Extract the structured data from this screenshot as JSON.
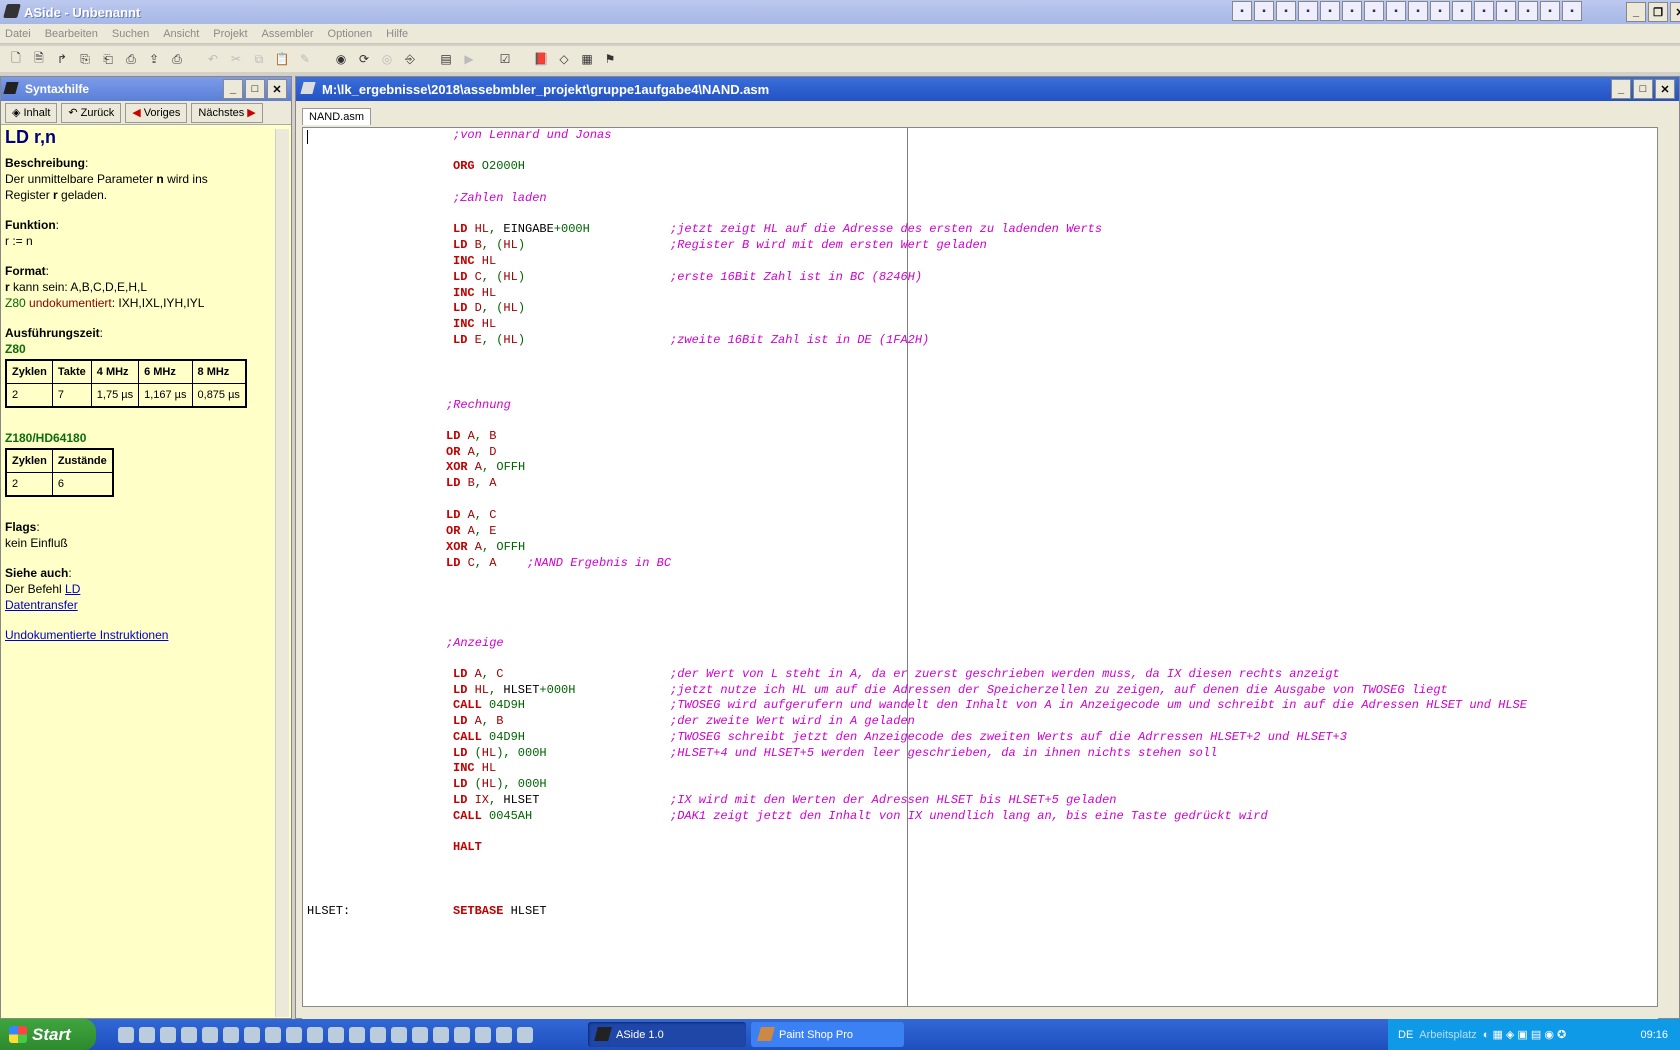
{
  "window": {
    "title": "ASide - Unbenannt"
  },
  "menu": [
    "Datei",
    "Bearbeiten",
    "Suchen",
    "Ansicht",
    "Projekt",
    "Assembler",
    "Optionen",
    "Hilfe"
  ],
  "quicklaunch_icons": [
    "icon-1",
    "icon-2",
    "icon-3",
    "icon-4",
    "icon-5",
    "icon-6",
    "icon-7",
    "icon-8",
    "icon-9",
    "icon-10",
    "icon-11",
    "icon-12",
    "icon-13",
    "icon-14",
    "icon-15",
    "icon-16"
  ],
  "left_panel": {
    "title": "Syntaxhilfe",
    "nav": {
      "inhalt": "Inhalt",
      "zurueck": "Zurück",
      "voriges": "Voriges",
      "naechstes": "Nächstes"
    },
    "heading": "LD r,n",
    "beschreibung_label": "Beschreibung",
    "beschreibung_text1": "Der unmittelbare Parameter ",
    "beschreibung_n": "n",
    "beschreibung_text2": " wird ins",
    "beschreibung_text3": "Register ",
    "beschreibung_r": "r",
    "beschreibung_text4": " geladen.",
    "funktion_label": "Funktion",
    "funktion_text": "r := n",
    "format_label": "Format",
    "format_r": "r",
    "format_text": " kann sein: A,B,C,D,E,H,L",
    "format_z80": "Z80",
    "format_undok": " undokumentiert",
    "format_undok_text": ": IXH,IXL,IYH,IYL",
    "zeit_label": "Ausführungszeit",
    "z80_label": "Z80",
    "z80_table": {
      "headers": [
        "Zyklen",
        "Takte",
        "4 MHz",
        "6 MHz",
        "8 MHz"
      ],
      "row": [
        "2",
        "7",
        "1,75 µs",
        "1,167 µs",
        "0,875 µs"
      ]
    },
    "z180_label": "Z180/HD64180",
    "z180_table": {
      "headers": [
        "Zyklen",
        "Zustände"
      ],
      "row": [
        "2",
        "6"
      ]
    },
    "flags_label": "Flags",
    "flags_text": "kein Einfluß",
    "siehe_label": "Siehe auch",
    "siehe_text": "Der Befehl ",
    "siehe_ld": "LD",
    "siehe_daten": "Datentransfer",
    "undok_link": "Undokumentierte Instruktionen"
  },
  "editor": {
    "title": "M:\\lk_ergebnisse\\2018\\assebmbler_projekt\\gruppe1aufgabe4\\NAND.asm",
    "tab": "NAND.asm",
    "lines": [
      {
        "l": "",
        "k": "",
        "a": "",
        "c": ";von Lennard und Jonas"
      },
      {
        "l": "",
        "k": "ORG",
        "a": " O2000H",
        "c": ""
      },
      {
        "l": "",
        "k": "",
        "a": "",
        "c": ";Zahlen laden"
      },
      {
        "l": "",
        "k": "LD",
        "a": " HL, EINGABE+000H",
        "c": ";jetzt zeigt HL auf die Adresse des ersten zu ladenden Werts"
      },
      {
        "l": "",
        "k": "LD",
        "a": " B, (HL)",
        "c": ";Register B wird mit dem ersten Wert geladen"
      },
      {
        "l": "",
        "k": "INC",
        "a": " HL",
        "c": ""
      },
      {
        "l": "",
        "k": "LD",
        "a": " C, (HL)",
        "c": ";erste 16Bit Zahl ist in BC (8246H)"
      },
      {
        "l": "",
        "k": "INC",
        "a": " HL",
        "c": ""
      },
      {
        "l": "",
        "k": "LD",
        "a": " D, (HL)",
        "c": ""
      },
      {
        "l": "",
        "k": "INC",
        "a": " HL",
        "c": ""
      },
      {
        "l": "",
        "k": "LD",
        "a": " E, (HL)",
        "c": ";zweite 16Bit Zahl ist in DE (1FA2H)"
      },
      {
        "l": "",
        "k": "",
        "a": "",
        "c": ";Rechnung"
      },
      {
        "l": "",
        "k": "LD",
        "a": " A, B",
        "c": ""
      },
      {
        "l": "",
        "k": "OR",
        "a": " A, D",
        "c": ""
      },
      {
        "l": "",
        "k": "XOR",
        "a": " A, OFFH",
        "c": ""
      },
      {
        "l": "",
        "k": "LD",
        "a": " B, A",
        "c": ""
      },
      {
        "l": "",
        "k": "LD",
        "a": " A, C",
        "c": ""
      },
      {
        "l": "",
        "k": "OR",
        "a": " A, E",
        "c": ""
      },
      {
        "l": "",
        "k": "XOR",
        "a": " A, OFFH",
        "c": ""
      },
      {
        "l": "",
        "k": "LD",
        "a": " C, A",
        "c": ";NAND Ergebnis in BC"
      },
      {
        "l": "",
        "k": "",
        "a": "",
        "c": ";Anzeige"
      },
      {
        "l": "",
        "k": "LD",
        "a": " A, C",
        "c": ";der Wert von L steht in A, da er zuerst geschrieben werden muss, da IX diesen rechts anzeigt"
      },
      {
        "l": "",
        "k": "LD",
        "a": " HL, HLSET+000H",
        "c": ";jetzt nutze ich HL um auf die Adressen der Speicherzellen zu zeigen, auf denen die Ausgabe von TWOSEG liegt"
      },
      {
        "l": "",
        "k": "CALL",
        "a": " 04D9H",
        "c": ";TWOSEG wird aufgerufern und wandelt den Inhalt von A in Anzeigecode um und schreibt in auf die Adressen HLSET und HLSE"
      },
      {
        "l": "",
        "k": "LD",
        "a": " A, B",
        "c": ";der zweite Wert wird in A geladen"
      },
      {
        "l": "",
        "k": "CALL",
        "a": " 04D9H",
        "c": ";TWOSEG schreibt jetzt den Anzeigecode des zweiten Werts auf die Adrressen HLSET+2 und HLSET+3"
      },
      {
        "l": "",
        "k": "LD",
        "a": " (HL), 000H",
        "c": ";HLSET+4 und HLSET+5 werden leer geschrieben, da in ihnen nichts stehen soll"
      },
      {
        "l": "",
        "k": "INC",
        "a": " HL",
        "c": ""
      },
      {
        "l": "",
        "k": "LD",
        "a": " (HL), 000H",
        "c": ""
      },
      {
        "l": "",
        "k": "LD",
        "a": " IX, HLSET",
        "c": ";IX wird mit den Werten der Adressen HLSET bis HLSET+5 geladen"
      },
      {
        "l": "",
        "k": "CALL",
        "a": " 0045AH",
        "c": ";DAK1 zeigt jetzt den Inhalt von IX unendlich lang an, bis eine Taste gedrückt wird"
      },
      {
        "l": "",
        "k": "HALT",
        "a": "",
        "c": ""
      },
      {
        "l": "HLSET:",
        "k": "SETBASE",
        "a": " HLSET",
        "c": ""
      }
    ]
  },
  "taskbar": {
    "start": "Start",
    "task1": "ASide 1.0",
    "task2": "Paint Shop Pro",
    "lang": "DE",
    "arbeitsplatz": "Arbeitsplatz",
    "clock": "09:16"
  }
}
